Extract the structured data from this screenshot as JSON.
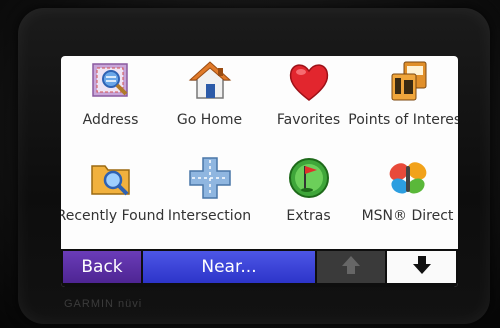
{
  "menu": {
    "items": [
      {
        "label": "Address",
        "icon": "address-book-icon"
      },
      {
        "label": "Go Home",
        "icon": "home-icon"
      },
      {
        "label": "Favorites",
        "icon": "heart-icon"
      },
      {
        "label": "Points of Interest",
        "icon": "points-of-interest-icon"
      },
      {
        "label": "Recently Found",
        "icon": "folder-search-icon"
      },
      {
        "label": "Intersection",
        "icon": "intersection-icon"
      },
      {
        "label": "Extras",
        "icon": "flag-icon"
      },
      {
        "label": "MSN® Direct",
        "icon": "msn-butterfly-icon"
      }
    ]
  },
  "toolbar": {
    "back_label": "Back",
    "near_label": "Near...",
    "up_icon": "arrow-up-icon",
    "down_icon": "arrow-down-icon"
  },
  "device": {
    "brand": "GARMIN nüvi"
  },
  "colors": {
    "back": "#5a2fa6",
    "near": "#3c44d8",
    "screen": "#fdfdfd"
  }
}
